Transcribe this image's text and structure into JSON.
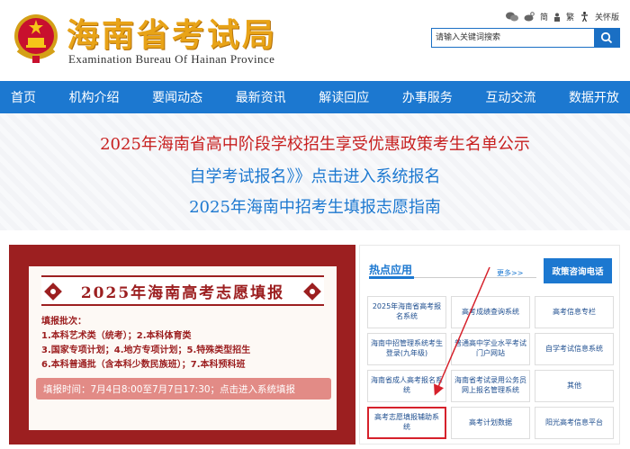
{
  "header": {
    "logo_text": "海南省考试局",
    "logo_en": "Examination Bureau Of Hainan Province",
    "top_links": {
      "simplified": "简",
      "traditional": "繁",
      "care": "关怀版"
    },
    "search": {
      "placeholder": "请输入关键词搜索"
    }
  },
  "nav": {
    "items": [
      "首页",
      "机构介绍",
      "要闻动态",
      "最新资讯",
      "解读回应",
      "办事服务",
      "互动交流",
      "数据开放"
    ]
  },
  "banner": {
    "lines": [
      "2025年海南省高中阶段学校招生享受优惠政策考生名单公示",
      "自学考试报名》》点击进入系统报名",
      "2025年海南中招考生填报志愿指南"
    ]
  },
  "promo": {
    "title": "2025年海南高考志愿填报",
    "subtitle": "填报批次：",
    "lines": [
      "1.本科艺术类（统考）；2.本科体育类",
      "3.国家专项计划；4.地方专项计划；5.特殊类型招生",
      "6.本科普通批（含本科少数民族班）；7.本科预科班"
    ],
    "bar_text": "填报时间：7月4日8:00至7月7日17:30；点击进入系统填报"
  },
  "hot": {
    "title": "热点应用",
    "more": "更多>>",
    "policy_button": "政策咨询电话",
    "items": [
      "2025年海南省高考报名系统",
      "高考成绩查询系统",
      "高考信息专栏",
      "海南中招管理系统考生登录(九年级)",
      "普通高中学业水平考试门户网站",
      "自学考试信息系统",
      "海南省成人高考报名系统",
      "海南省考试录用公务员网上报名管理系统",
      "其他",
      "高考志愿填报辅助系统",
      "高考计划数据",
      "阳光高考信息平台"
    ]
  },
  "colors": {
    "nav_blue": "#1c78d0",
    "logo_gold": "#e8a317",
    "banner_red": "#c71f1f",
    "promo_red": "#9c1f20",
    "highlight_red": "#d6212b"
  }
}
